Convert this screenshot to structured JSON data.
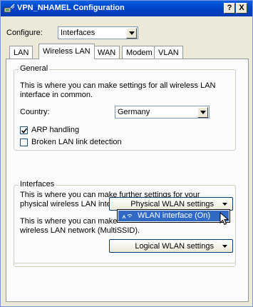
{
  "window": {
    "title": "VPN_NHAMEL Configuration",
    "help_label": "?",
    "close_label": "X"
  },
  "configure": {
    "label": "Configure:",
    "value": "Interfaces"
  },
  "tabs": [
    {
      "label": "LAN"
    },
    {
      "label": "Wireless LAN",
      "active": true
    },
    {
      "label": "WAN"
    },
    {
      "label": "Modem"
    },
    {
      "label": "VLAN"
    }
  ],
  "general": {
    "title": "General",
    "description": "This is where you can make settings for all wireless LAN interface in common.",
    "country_label": "Country:",
    "country_value": "Germany",
    "arp_label": "ARP handling",
    "arp_checked": true,
    "broken_label": "Broken LAN link detection",
    "broken_checked": false
  },
  "interfaces": {
    "title": "Interfaces",
    "description": "This is where you can make further settings for your physical wireless LAN interface.",
    "physical_button": "Physical WLAN settings",
    "menu_item": "WLAN interface (On)",
    "logical_description_start": "This is where you can make",
    "logical_description_end": "wireless LAN network (MultiSSID).",
    "logical_button": "Logical WLAN settings"
  }
}
